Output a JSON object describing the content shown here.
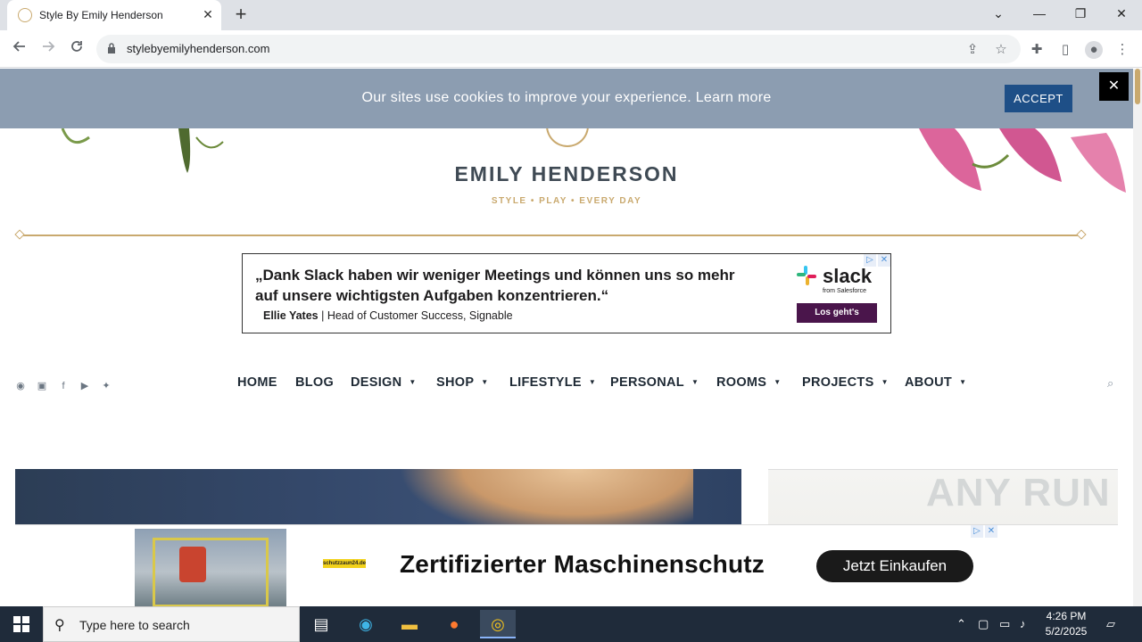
{
  "browser": {
    "tab_title": "Style By Emily Henderson",
    "tab_close": "✕",
    "new_tab": "+",
    "url": "stylebyemilyhenderson.com",
    "window_controls": {
      "tab_search": "⌄",
      "minimize": "—",
      "restore": "❐",
      "close": "✕"
    }
  },
  "cookie_banner": {
    "message": "Our sites use cookies to improve your experience. Learn more",
    "accept_label": "ACCEPT",
    "close_label": "✕"
  },
  "site": {
    "logo_name": "EMILY HENDERSON",
    "tagline": "STYLE  •  PLAY  •  EVERY DAY",
    "accent_color": "#c9a96e"
  },
  "ad_top": {
    "quote": "„Dank Slack haben wir weniger Meetings und können uns so mehr auf unsere wichtigsten Aufgaben konzentrieren.“",
    "person_name": "Ellie Yates",
    "person_role": " | Head of Customer Success, Signable",
    "brand": "slack",
    "brand_sub": "from Salesforce",
    "cta": "Los geht's",
    "brand_color": "#4a154b"
  },
  "social_icons": [
    "pinterest-icon",
    "instagram-icon",
    "facebook-icon",
    "youtube-icon",
    "twitter-icon"
  ],
  "nav": {
    "items": [
      {
        "label": "HOME",
        "dropdown": false
      },
      {
        "label": "BLOG",
        "dropdown": false
      },
      {
        "label": "DESIGN",
        "dropdown": true
      },
      {
        "label": "SHOP",
        "dropdown": true
      },
      {
        "label": "LIFESTYLE",
        "dropdown": true
      },
      {
        "label": "PERSONAL",
        "dropdown": true
      },
      {
        "label": "ROOMS",
        "dropdown": true
      },
      {
        "label": "PROJECTS",
        "dropdown": true
      },
      {
        "label": "ABOUT",
        "dropdown": true
      }
    ],
    "caret": "▼"
  },
  "ad_bottom": {
    "shop_logo": "schutzzaun24.de",
    "headline": "Zertifizierter Maschinenschutz",
    "cta": "Jetzt Einkaufen"
  },
  "watermark": "ANY RUN",
  "taskbar": {
    "search_placeholder": "Type here to search",
    "time": "4:26 PM",
    "date": "5/2/2025"
  }
}
